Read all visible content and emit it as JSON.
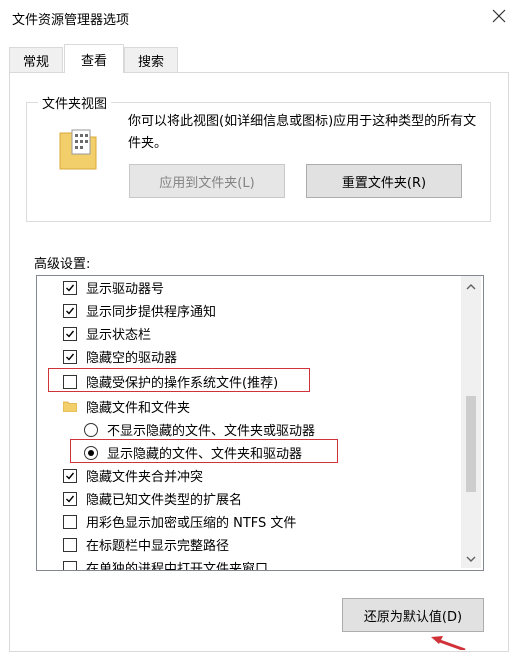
{
  "window": {
    "title": "文件资源管理器选项"
  },
  "tabs": [
    {
      "label": "常规"
    },
    {
      "label": "查看"
    },
    {
      "label": "搜索"
    }
  ],
  "folder_view": {
    "group_label": "文件夹视图",
    "description": "你可以将此视图(如详细信息或图标)应用于这种类型的所有文件夹。",
    "apply_button": "应用到文件夹(L)",
    "reset_button": "重置文件夹(R)"
  },
  "advanced": {
    "label": "高级设置:",
    "items": [
      {
        "type": "checkbox",
        "label": "显示驱动器号",
        "checked": true
      },
      {
        "type": "checkbox",
        "label": "显示同步提供程序通知",
        "checked": true
      },
      {
        "type": "checkbox",
        "label": "显示状态栏",
        "checked": true
      },
      {
        "type": "checkbox",
        "label": "隐藏空的驱动器",
        "checked": true
      },
      {
        "type": "checkbox",
        "label": "隐藏受保护的操作系统文件(推荐)",
        "checked": false
      },
      {
        "type": "folder",
        "label": "隐藏文件和文件夹"
      },
      {
        "type": "radio",
        "label": "不显示隐藏的文件、文件夹或驱动器",
        "checked": false
      },
      {
        "type": "radio",
        "label": "显示隐藏的文件、文件夹和驱动器",
        "checked": true
      },
      {
        "type": "checkbox",
        "label": "隐藏文件夹合并冲突",
        "checked": true
      },
      {
        "type": "checkbox",
        "label": "隐藏已知文件类型的扩展名",
        "checked": true
      },
      {
        "type": "checkbox",
        "label": "用彩色显示加密或压缩的 NTFS 文件",
        "checked": false
      },
      {
        "type": "checkbox",
        "label": "在标题栏中显示完整路径",
        "checked": false
      },
      {
        "type": "checkbox",
        "label": "在单独的进程中打开文件夹窗口",
        "checked": false
      }
    ]
  },
  "restore_button": "还原为默认值(D)",
  "colors": {
    "highlight": "#d0323a",
    "folder": "#f3cf6b"
  }
}
